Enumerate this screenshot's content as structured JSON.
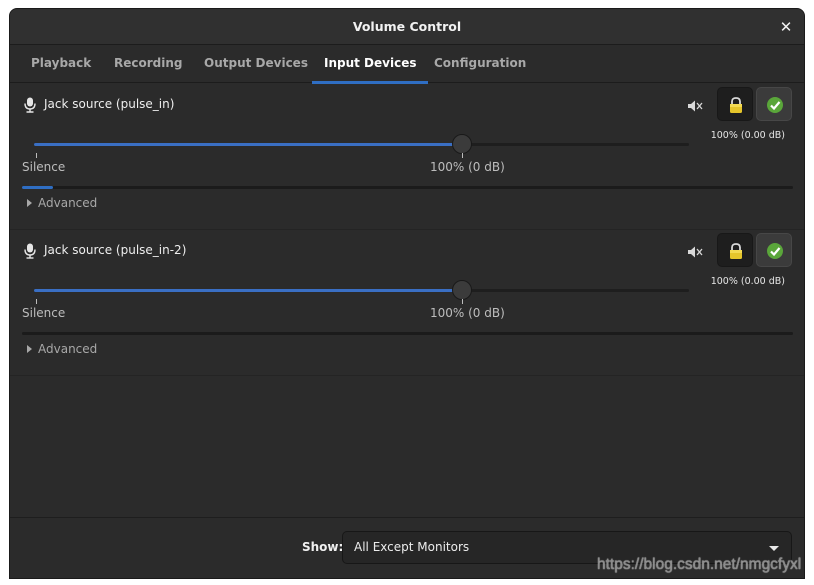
{
  "window": {
    "title": "Volume Control"
  },
  "tabs": [
    {
      "label": "Playback",
      "active": false
    },
    {
      "label": "Recording",
      "active": false
    },
    {
      "label": "Output Devices",
      "active": false
    },
    {
      "label": "Input Devices",
      "active": true
    },
    {
      "label": "Configuration",
      "active": false
    }
  ],
  "devices": [
    {
      "name": "Jack source (pulse_in)",
      "volume_percent": 100,
      "db_label": "100% (0.00 dB)",
      "mark_min_label": "Silence",
      "mark_100_label": "100% (0 dB)",
      "level_fraction": 0.04,
      "advanced_label": "Advanced",
      "locked": true,
      "is_default": true
    },
    {
      "name": "Jack source (pulse_in-2)",
      "volume_percent": 100,
      "db_label": "100% (0.00 dB)",
      "mark_min_label": "Silence",
      "mark_100_label": "100% (0 dB)",
      "level_fraction": 0.0,
      "advanced_label": "Advanced",
      "locked": true,
      "is_default": true
    }
  ],
  "footer": {
    "show_label": "Show:",
    "show_value": "All Except Monitors"
  },
  "watermark": "https://blog.csdn.net/nmgcfyxl",
  "colors": {
    "accent": "#2f6ec3",
    "window_bg": "#2b2b2b",
    "lock_yellow": "#e5c52b",
    "default_green": "#5aa63a"
  },
  "icons": {
    "close": "close-icon",
    "microphone": "microphone-icon",
    "mute": "speaker-muted-icon",
    "lock": "lock-icon",
    "default": "checkmark-icon",
    "dropdown": "chevron-down-icon"
  }
}
